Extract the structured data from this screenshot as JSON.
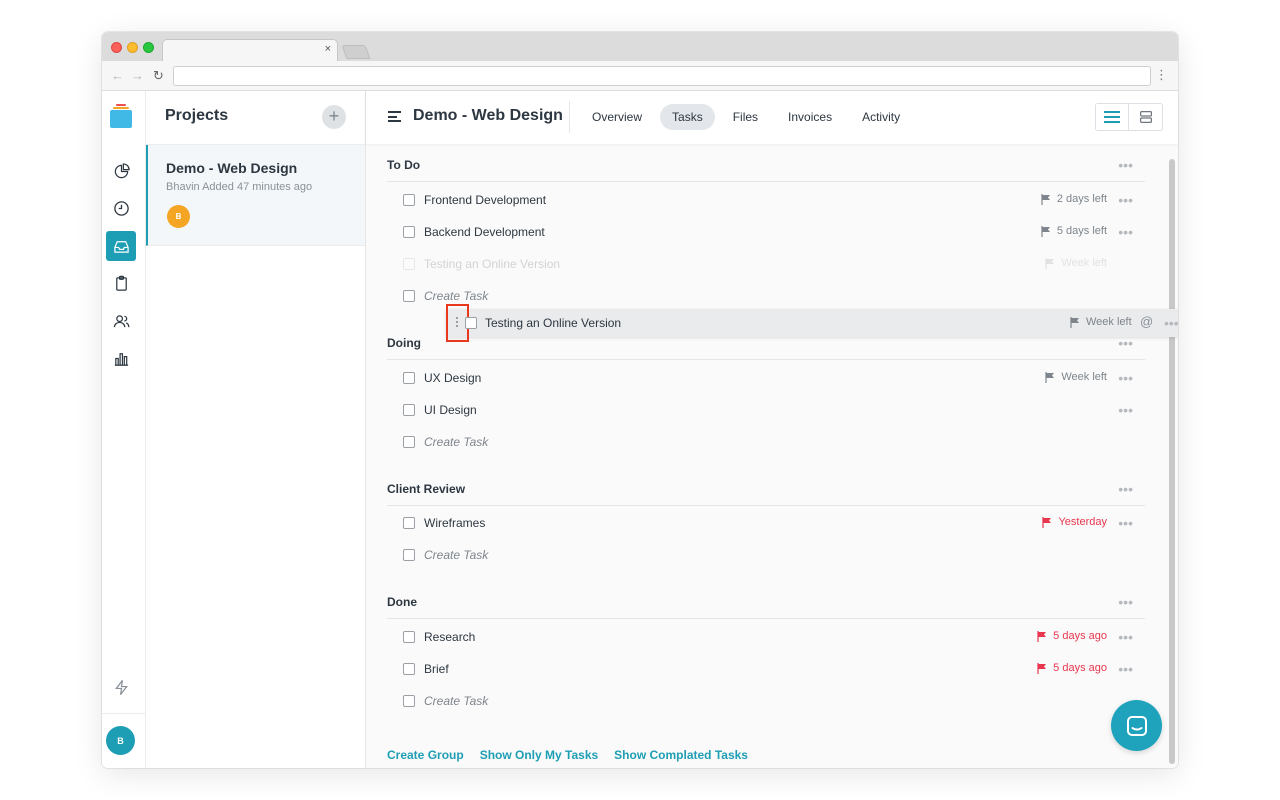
{
  "browser": {
    "tab_close": "×",
    "url": "",
    "nav_back": "←",
    "nav_forward": "→",
    "nav_reload": "↻",
    "menu": "⋮"
  },
  "rail": {
    "items": [
      {
        "icon": "pie-chart-icon"
      },
      {
        "icon": "clock-icon"
      },
      {
        "icon": "inbox-icon",
        "active": true
      },
      {
        "icon": "clipboard-icon"
      },
      {
        "icon": "users-icon"
      },
      {
        "icon": "bar-chart-icon"
      }
    ],
    "bottom_icon": "lightning-icon",
    "user_initial": "B",
    "accent": "#1e9eb4"
  },
  "projects": {
    "title": "Projects",
    "add_label": "+",
    "items": [
      {
        "name": "Demo - Web Design",
        "meta": "Bhavin Added 47 minutes ago",
        "avatar_initial": "B",
        "avatar_color": "#f5a524"
      }
    ]
  },
  "header": {
    "title": "Demo - Web Design",
    "tabs": [
      {
        "label": "Overview"
      },
      {
        "label": "Tasks",
        "active": true
      },
      {
        "label": "Files"
      },
      {
        "label": "Invoices"
      },
      {
        "label": "Activity"
      }
    ],
    "views": [
      "list-view-icon",
      "board-view-icon"
    ]
  },
  "groups": [
    {
      "title": "To Do",
      "tasks": [
        {
          "name": "Frontend Development",
          "due": "2 days left",
          "overdue": false
        },
        {
          "name": "Backend Development",
          "due": "5 days left",
          "overdue": false
        },
        {
          "name": "Testing an Online Version",
          "due": "Week left",
          "overdue": false,
          "ghost": true
        }
      ],
      "create_label": "Create Task"
    },
    {
      "title": "Doing",
      "tasks": [
        {
          "name": "UX Design",
          "due": "Week left",
          "overdue": false
        },
        {
          "name": "UI Design",
          "due": "",
          "overdue": false
        }
      ],
      "create_label": "Create Task"
    },
    {
      "title": "Client Review",
      "tasks": [
        {
          "name": "Wireframes",
          "due": "Yesterday",
          "overdue": true
        }
      ],
      "create_label": "Create Task"
    },
    {
      "title": "Done",
      "tasks": [
        {
          "name": "Research",
          "due": "5 days ago",
          "overdue": true
        },
        {
          "name": "Brief",
          "due": "5 days ago",
          "overdue": true
        }
      ],
      "create_label": "Create Task"
    }
  ],
  "dragging": {
    "name": "Testing an Online Version",
    "due": "Week left",
    "mention": "@"
  },
  "footer": {
    "create_group": "Create Group",
    "show_my_tasks": "Show Only My Tasks",
    "show_completed": "Show Complated Tasks"
  },
  "dots_label": "•••",
  "colors": {
    "accent": "#1e9eb4",
    "overdue": "#e8364e",
    "highlight": "#e8391e"
  },
  "chat": {
    "icon": "chat-icon"
  }
}
